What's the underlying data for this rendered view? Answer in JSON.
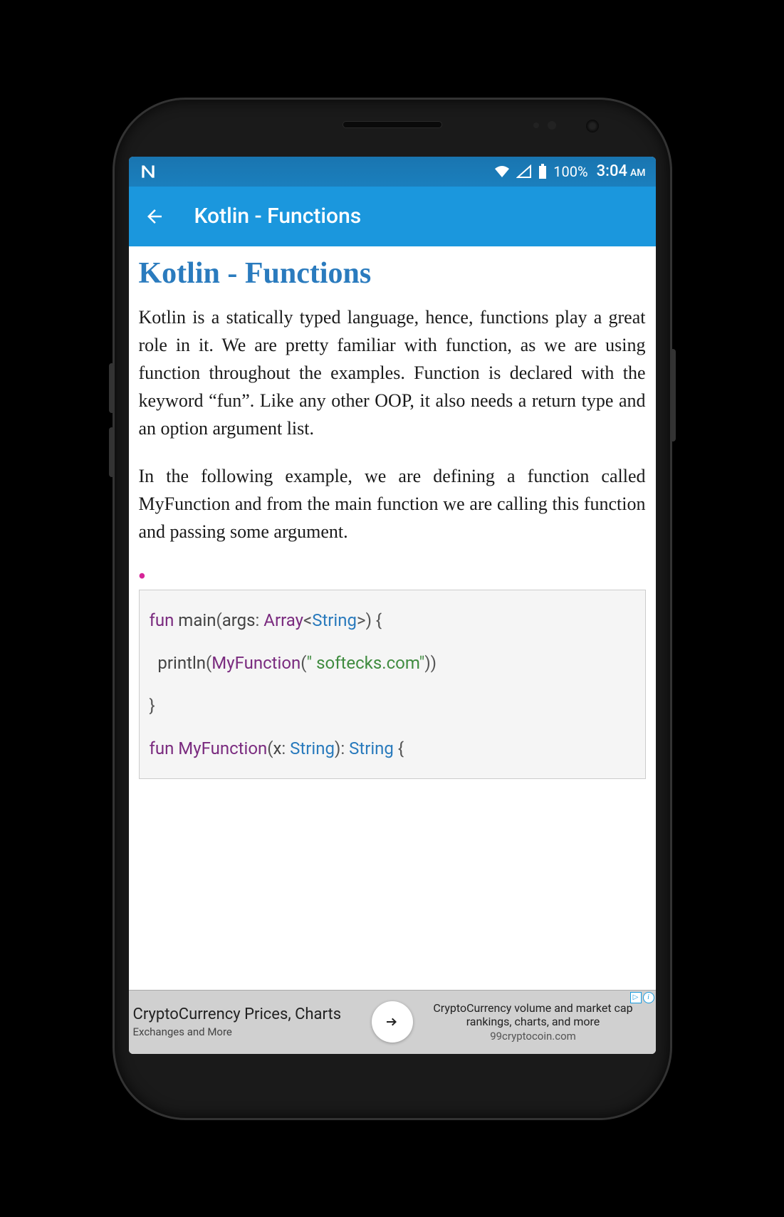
{
  "status": {
    "battery_pct": "100%",
    "time": "3:04",
    "ampm": "AM"
  },
  "appbar": {
    "title": "Kotlin - Functions"
  },
  "page": {
    "heading": "Kotlin - Functions",
    "para1": "Kotlin is a statically typed language, hence, functions play a great role in it. We are pretty familiar with function, as we are using function throughout the examples. Function is declared with the keyword “fun”. Like any other OOP, it also needs a return type and an option argument list.",
    "para2": "In the following example, we are defining a function called MyFunction and from the main function we are calling this function and passing some argument."
  },
  "code": {
    "l1_fun": "fun",
    "l1_main": " main",
    "l1_p1": "(",
    "l1_args": "args",
    "l1_colon": ": ",
    "l1_arr": "Array",
    "l1_lt": "<",
    "l1_str": "String",
    "l1_gt": ">",
    "l1_p2": ") {",
    "l2_print": "println",
    "l2_p1": "(",
    "l2_fn": "MyFunction",
    "l2_p2": "(",
    "l2_strlit": "\" softecks.com\"",
    "l2_p3": "))",
    "l3_close": "}",
    "l4_fun": "fun",
    "l4_name": " MyFunction",
    "l4_p1": "(",
    "l4_x": "x",
    "l4_colon": ": ",
    "l4_str1": "String",
    "l4_p2": "): ",
    "l4_str2": "String",
    "l4_brace": " {"
  },
  "ad": {
    "left_title": "CryptoCurrency Prices, Charts",
    "left_sub": "Exchanges and More",
    "right_text": "CryptoCurrency volume and market cap rankings, charts, and more",
    "right_domain": "99cryptocoin.com",
    "close_symbol": "▷",
    "info_symbol": "i"
  }
}
